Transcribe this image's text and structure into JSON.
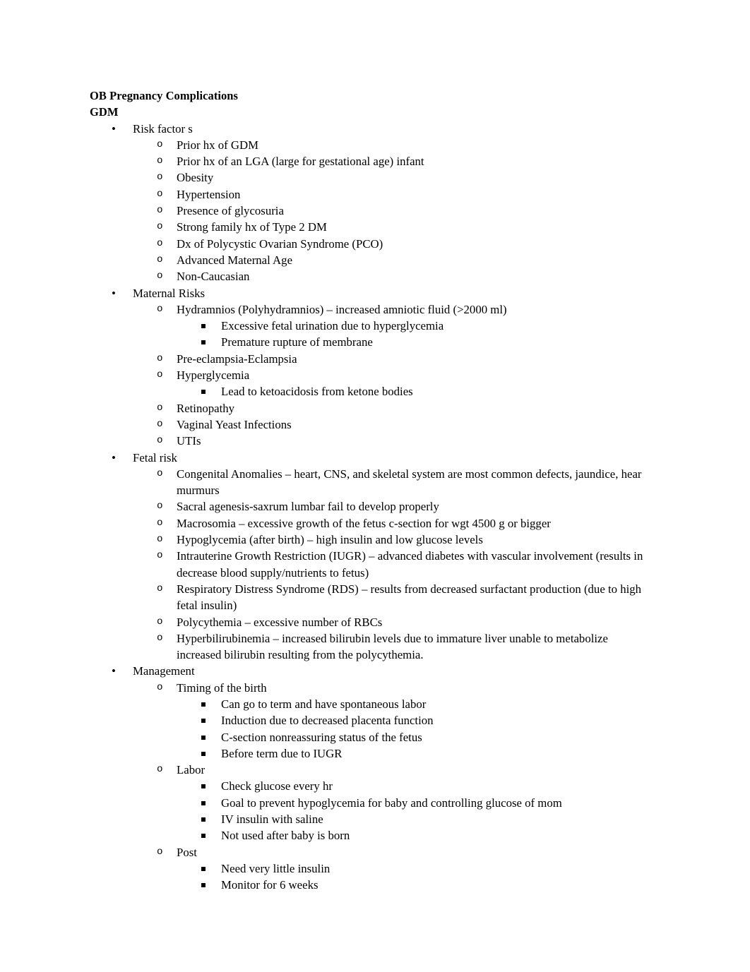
{
  "document": {
    "title": "OB Pregnancy Complications",
    "subtitle": "GDM",
    "sections": [
      {
        "label": "Risk factor s",
        "children": [
          {
            "label": "Prior hx of GDM"
          },
          {
            "label": "Prior hx of an LGA (large for gestational age) infant"
          },
          {
            "label": "Obesity"
          },
          {
            "label": "Hypertension"
          },
          {
            "label": "Presence of glycosuria"
          },
          {
            "label": "Strong family hx of Type 2 DM"
          },
          {
            "label": "Dx of Polycystic Ovarian Syndrome (PCO)"
          },
          {
            "label": "Advanced Maternal Age"
          },
          {
            "label": "Non-Caucasian"
          }
        ]
      },
      {
        "label": "Maternal Risks",
        "children": [
          {
            "label": "Hydramnios (Polyhydramnios) – increased amniotic fluid (>2000 ml)",
            "children": [
              {
                "label": "Excessive fetal urination due to hyperglycemia"
              },
              {
                "label": "Premature rupture of membrane"
              }
            ]
          },
          {
            "label": "Pre-eclampsia-Eclampsia"
          },
          {
            "label": "Hyperglycemia",
            "children": [
              {
                "label": "Lead to ketoacidosis from ketone bodies"
              }
            ]
          },
          {
            "label": "Retinopathy"
          },
          {
            "label": "Vaginal Yeast Infections"
          },
          {
            "label": "UTIs"
          }
        ]
      },
      {
        "label": "Fetal risk",
        "children": [
          {
            "label": "Congenital Anomalies – heart, CNS, and skeletal system are most common defects, jaundice, hear murmurs"
          },
          {
            "label": "Sacral agenesis-saxrum lumbar fail to develop properly"
          },
          {
            "label": "Macrosomia – excessive growth of the fetus c-section for wgt 4500 g or bigger"
          },
          {
            "label": "Hypoglycemia (after birth) – high insulin and low glucose levels"
          },
          {
            "label": "Intrauterine Growth Restriction (IUGR) – advanced diabetes with vascular involvement (results in decrease blood supply/nutrients to fetus)"
          },
          {
            "label": "Respiratory Distress Syndrome (RDS) – results from decreased surfactant production (due to high fetal insulin)"
          },
          {
            "label": "Polycythemia – excessive number of RBCs"
          },
          {
            "label": "Hyperbilirubinemia – increased bilirubin levels due to immature liver unable to metabolize increased bilirubin resulting from the polycythemia."
          }
        ]
      },
      {
        "label": "Management",
        "children": [
          {
            "label": "Timing of the birth",
            "children": [
              {
                "label": "Can go to term and have spontaneous labor"
              },
              {
                "label": "Induction due to decreased placenta function"
              },
              {
                "label": "C-section nonreassuring status of the fetus"
              },
              {
                "label": "Before term due to IUGR"
              }
            ]
          },
          {
            "label": "Labor",
            "children": [
              {
                "label": "Check glucose every hr"
              },
              {
                "label": "Goal to prevent hypoglycemia for baby and controlling glucose of mom"
              },
              {
                "label": "IV insulin with saline"
              },
              {
                "label": "Not used after baby is born"
              }
            ]
          },
          {
            "label": "Post",
            "children": [
              {
                "label": "Need very little insulin"
              },
              {
                "label": "Monitor for 6 weeks"
              }
            ]
          }
        ]
      }
    ]
  }
}
